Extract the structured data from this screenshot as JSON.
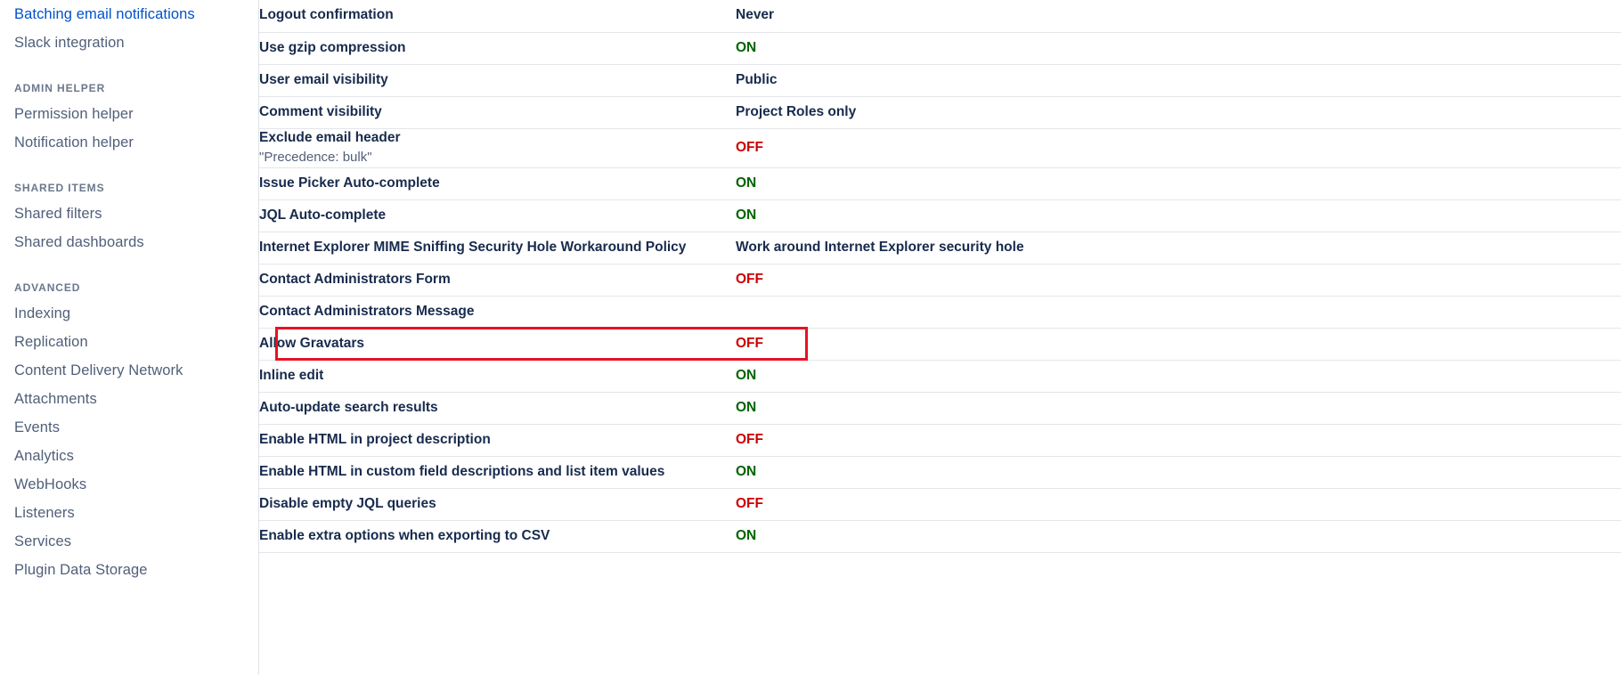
{
  "sidebar": {
    "top_items": [
      {
        "label": "Batching email notifications"
      },
      {
        "label": "Slack integration"
      }
    ],
    "sections": [
      {
        "title": "ADMIN HELPER",
        "items": [
          {
            "label": "Permission helper"
          },
          {
            "label": "Notification helper"
          }
        ]
      },
      {
        "title": "SHARED ITEMS",
        "items": [
          {
            "label": "Shared filters"
          },
          {
            "label": "Shared dashboards"
          }
        ]
      },
      {
        "title": "ADVANCED",
        "items": [
          {
            "label": "Indexing"
          },
          {
            "label": "Replication"
          },
          {
            "label": "Content Delivery Network"
          },
          {
            "label": "Attachments"
          },
          {
            "label": "Events"
          },
          {
            "label": "Analytics"
          },
          {
            "label": "WebHooks"
          },
          {
            "label": "Listeners"
          },
          {
            "label": "Services"
          },
          {
            "label": "Plugin Data Storage"
          }
        ]
      }
    ]
  },
  "colors": {
    "on": "#006400",
    "off": "#cc0000",
    "text": "#172b4d",
    "highlight_border": "#e81123",
    "divider": "#e4e6ea",
    "sidebar_text": "#505f79",
    "sidebar_section": "#6b778c"
  },
  "settings_table": {
    "rows": [
      {
        "label": "Logout confirmation",
        "sub": "",
        "value": "Never",
        "state": "text",
        "highlighted": false
      },
      {
        "label": "Use gzip compression",
        "sub": "",
        "value": "ON",
        "state": "on",
        "highlighted": false
      },
      {
        "label": "User email visibility",
        "sub": "",
        "value": "Public",
        "state": "text",
        "highlighted": false
      },
      {
        "label": "Comment visibility",
        "sub": "",
        "value": "Project Roles only",
        "state": "text",
        "highlighted": false
      },
      {
        "label": "Exclude email header",
        "sub": "\"Precedence: bulk\"",
        "value": "OFF",
        "state": "off",
        "highlighted": false
      },
      {
        "label": "Issue Picker Auto-complete",
        "sub": "",
        "value": "ON",
        "state": "on",
        "highlighted": false
      },
      {
        "label": "JQL Auto-complete",
        "sub": "",
        "value": "ON",
        "state": "on",
        "highlighted": false
      },
      {
        "label": "Internet Explorer MIME Sniffing Security Hole Workaround Policy",
        "sub": "",
        "value": "Work around Internet Explorer security hole",
        "state": "text",
        "highlighted": false
      },
      {
        "label": "Contact Administrators Form",
        "sub": "",
        "value": "OFF",
        "state": "off",
        "highlighted": false
      },
      {
        "label": "Contact Administrators Message",
        "sub": "",
        "value": "",
        "state": "text",
        "highlighted": false
      },
      {
        "label": "Allow Gravatars",
        "sub": "",
        "value": "OFF",
        "state": "off",
        "highlighted": true
      },
      {
        "label": "Inline edit",
        "sub": "",
        "value": "ON",
        "state": "on",
        "highlighted": false
      },
      {
        "label": "Auto-update search results",
        "sub": "",
        "value": "ON",
        "state": "on",
        "highlighted": false
      },
      {
        "label": "Enable HTML in project description",
        "sub": "",
        "value": "OFF",
        "state": "off",
        "highlighted": false
      },
      {
        "label": "Enable HTML in custom field descriptions and list item values",
        "sub": "",
        "value": "ON",
        "state": "on",
        "highlighted": false
      },
      {
        "label": "Disable empty JQL queries",
        "sub": "",
        "value": "OFF",
        "state": "off",
        "highlighted": false
      },
      {
        "label": "Enable extra options when exporting to CSV",
        "sub": "",
        "value": "ON",
        "state": "on",
        "highlighted": false
      }
    ]
  }
}
